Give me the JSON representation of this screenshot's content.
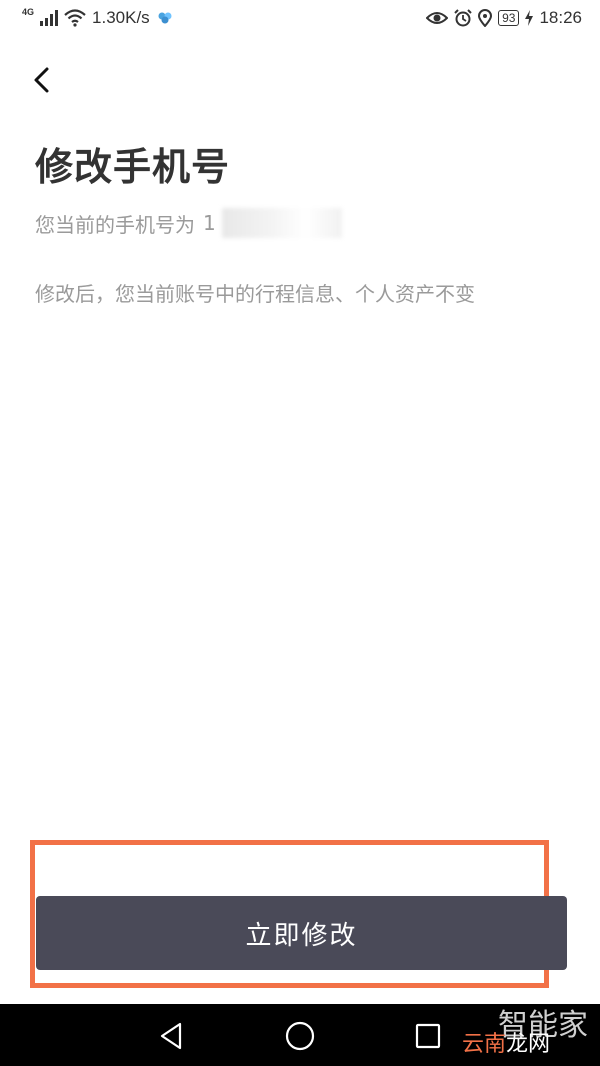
{
  "status_bar": {
    "network": "4G",
    "speed": "1.30K/s",
    "battery": "93",
    "time": "18:26"
  },
  "page": {
    "title": "修改手机号",
    "phone_prefix": "您当前的手机号为",
    "phone_visible": "1",
    "note": "修改后，您当前账号中的行程信息、个人资产不变"
  },
  "actions": {
    "change_now": "立即修改"
  },
  "watermark": {
    "top": "智能家",
    "bottom_a": "云南",
    "bottom_b": "龙网"
  },
  "colors": {
    "button_bg": "#4a4a58",
    "highlight": "#f27147",
    "muted_text": "#9a9a9a",
    "title_text": "#333333"
  }
}
